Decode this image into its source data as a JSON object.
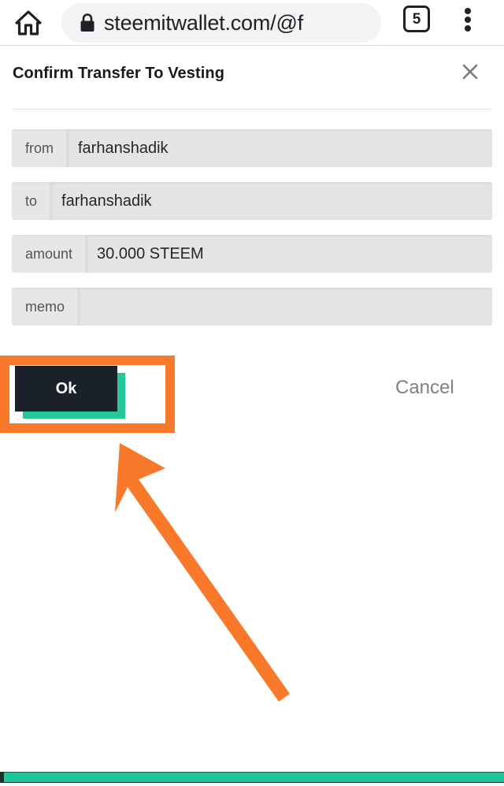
{
  "browser": {
    "home_icon": "home-icon",
    "lock_icon": "lock-icon",
    "url": "steemitwallet.com/@f",
    "tab_count": "5",
    "menu_icon": "overflow-menu-icon"
  },
  "dialog": {
    "title": "Confirm Transfer To Vesting",
    "close_icon": "close-icon",
    "rows": [
      {
        "label": "from",
        "value": "farhanshadik"
      },
      {
        "label": "to",
        "value": "farhanshadik"
      },
      {
        "label": "amount",
        "value": "30.000 STEEM"
      },
      {
        "label": "memo",
        "value": ""
      }
    ],
    "ok_label": "Ok",
    "cancel_label": "Cancel"
  },
  "annotations": {
    "highlight_color": "#f9792a",
    "arrow_color": "#f9792a",
    "arrow_icon": "pointing-arrow-icon",
    "highlight_target": "ok-button"
  },
  "colors": {
    "accent_teal": "#1ec49a",
    "button_dark": "#1b212b",
    "button_shadow_teal": "#25c997",
    "field_gray": "#e4e4e4",
    "label_gray": "#e7e7e7"
  },
  "bottom_bar": {
    "color": "#1ec49a"
  }
}
